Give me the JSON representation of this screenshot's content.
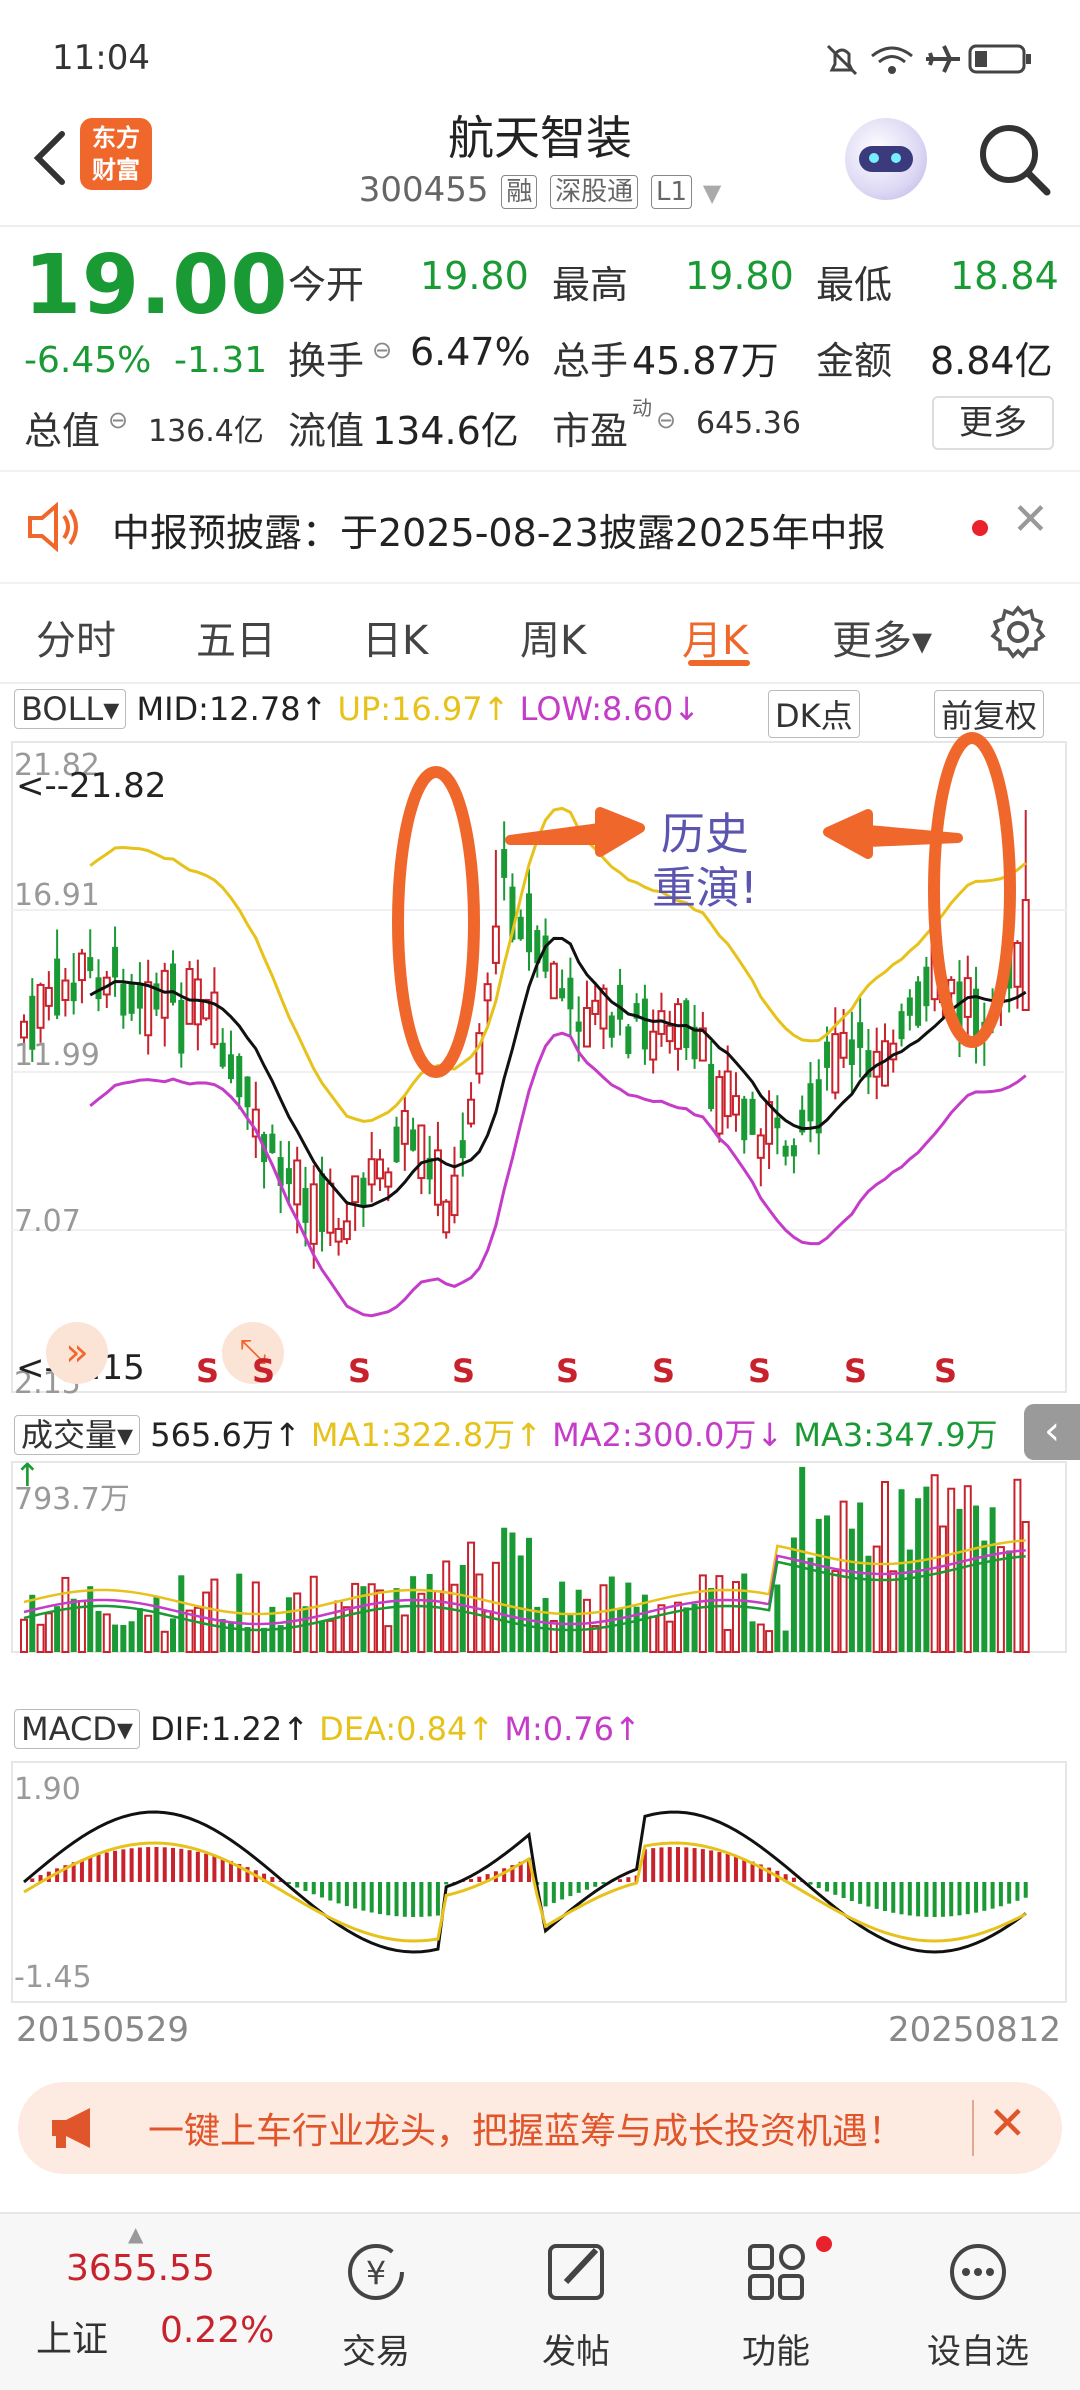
{
  "status": {
    "time": "11:04"
  },
  "header": {
    "logo_line1": "东方",
    "logo_line2": "财富",
    "name": "航天智装",
    "code": "300455",
    "tags": [
      "融",
      "深股通",
      "L1"
    ]
  },
  "quote": {
    "price": "19.00",
    "change_pct": "-6.45%",
    "change": "-1.31",
    "open_label": "今开",
    "open": "19.80",
    "high_label": "最高",
    "high": "19.80",
    "low_label": "最低",
    "low": "18.84",
    "turnover_label": "换手",
    "turnover": "6.47%",
    "volume_label": "总手",
    "volume": "45.87万",
    "amount_label": "金额",
    "amount": "8.84亿",
    "mktcap_label": "总值",
    "mktcap": "136.4亿",
    "float_label": "流值",
    "float": "134.6亿",
    "pe_label": "市盈",
    "pe_sup": "动",
    "pe": "645.36",
    "more_label": "更多"
  },
  "notice": {
    "text": "中报预披露：于2025-08-23披露2025年中报"
  },
  "tabs": [
    "分时",
    "五日",
    "日K",
    "周K",
    "月K",
    "更多▾"
  ],
  "boll": {
    "name": "BOLL",
    "mid": "MID:12.78↑",
    "up": "UP:16.97↑",
    "low": "LOW:8.60↓",
    "dk": "DK点",
    "fq": "前复权",
    "axis": [
      "21.82",
      "16.91",
      "11.99",
      "7.07",
      "2.15"
    ],
    "hi_marker": "<--21.82",
    "lo_marker": "<--2.15",
    "annotation_line1": "历史",
    "annotation_line2": "重演!",
    "s_label": "S"
  },
  "volume": {
    "name": "成交量",
    "value": "565.6万↑",
    "ma1": "MA1:322.8万↑",
    "ma2": "MA2:300.0万↓",
    "ma3": "MA3:347.9万↑",
    "axis_top": "793.7万"
  },
  "macd": {
    "name": "MACD",
    "dif": "DIF:1.22↑",
    "dea": "DEA:0.84↑",
    "m": "M:0.76↑",
    "axis_top": "1.90",
    "axis_bottom": "-1.45"
  },
  "dates": {
    "start": "20150529",
    "end": "20250812"
  },
  "banner": {
    "text": "一键上车行业龙头，把握蓝筹与成长投资机遇！"
  },
  "bottom_nav": {
    "index_value": "3655.55",
    "index_name": "上证",
    "index_change": "0.22%",
    "items": [
      "交易",
      "发帖",
      "功能",
      "设自选"
    ]
  },
  "colors": {
    "up": "#c8232c",
    "down": "#1a9a34",
    "accent": "#f0672b",
    "boll_up": "#e6c21a",
    "boll_low": "#c43cc8"
  }
}
